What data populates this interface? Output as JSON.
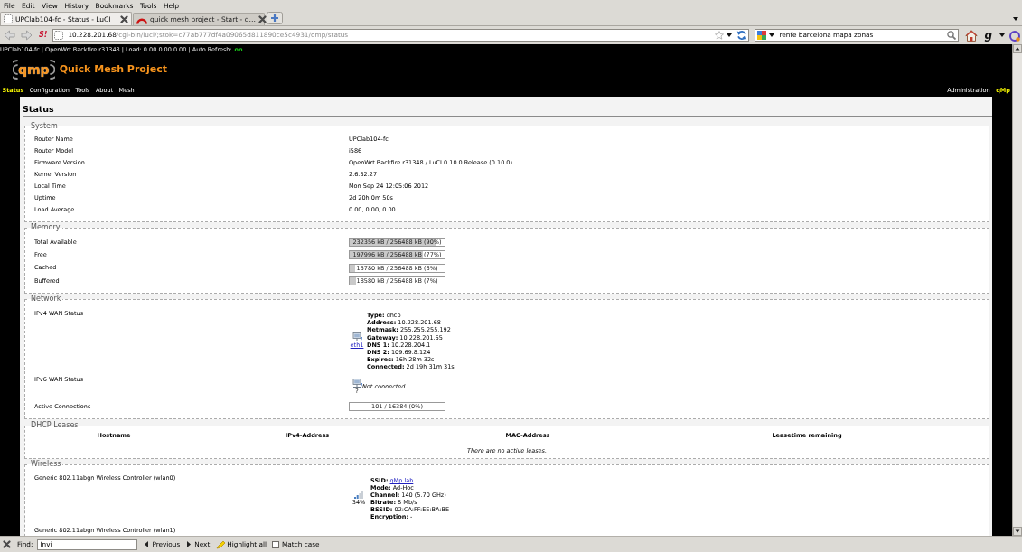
{
  "menu_bar": [
    "File",
    "Edit",
    "View",
    "History",
    "Bookmarks",
    "Tools",
    "Help"
  ],
  "tabs": [
    {
      "title": "UPClab104-fc - Status - LuCI",
      "kind": "blank",
      "selected": true
    },
    {
      "title": "quick mesh project - Start - q…",
      "kind": "arc",
      "selected": false
    }
  ],
  "toolbar": {
    "addon_label": "S!",
    "url_host": "10.228.201.68",
    "url_path": "/cgi-bin/luci/;stok=c77ab777df4a09065d811890ce5c4931/qmp/status",
    "search_value": "renfe barcelona mapa zonas",
    "addon_g": "g"
  },
  "page": {
    "info_line": "UPClab104-fc | OpenWrt Backfire r31348 | Load: 0.00 0.00 0.00 | Auto Refresh:",
    "auto_refresh": "on",
    "logo_text": "qmp",
    "site_title": "Quick Mesh Project",
    "menu": [
      {
        "label": "Status",
        "selected": true
      },
      {
        "label": "Configuration",
        "selected": false
      },
      {
        "label": "Tools",
        "selected": false
      },
      {
        "label": "About",
        "selected": false
      },
      {
        "label": "Mesh",
        "selected": false
      }
    ],
    "menu_right": [
      {
        "label": "Administration",
        "selected": false
      },
      {
        "label": "qMp",
        "selected": true
      }
    ],
    "heading": "Status",
    "system": {
      "legend": "System",
      "rows": [
        {
          "label": "Router Name",
          "value": "UPClab104-fc"
        },
        {
          "label": "Router Model",
          "value": "i586"
        },
        {
          "label": "Firmware Version",
          "value": "OpenWrt Backfire r31348 / LuCI 0.10.0 Release (0.10.0)"
        },
        {
          "label": "Kernel Version",
          "value": "2.6.32.27"
        },
        {
          "label": "Local Time",
          "value": "Mon Sep 24 12:05:06 2012"
        },
        {
          "label": "Uptime",
          "value": "2d 20h 0m 50s"
        },
        {
          "label": "Load Average",
          "value": "0.00, 0.00, 0.00"
        }
      ]
    },
    "memory": {
      "legend": "Memory",
      "rows": [
        {
          "label": "Total Available",
          "reading": "232356 kB / 256488 kB (90%)",
          "level": 0.9
        },
        {
          "label": "Free",
          "reading": "197996 kB / 256488 kB (77%)",
          "level": 0.77
        },
        {
          "label": "Cached",
          "reading": "15780 kB / 256488 kB (6%)",
          "level": 0.06
        },
        {
          "label": "Buffered",
          "reading": "18580 kB / 256488 kB (7%)",
          "level": 0.07
        }
      ]
    },
    "network": {
      "legend": "Network",
      "ipv4": {
        "label": "IPv4 WAN Status",
        "interface": "eth1",
        "details": [
          "**Type:** dhcp",
          "**Address:** 10.228.201.68",
          "**Netmask:** 255.255.255.192",
          "**Gateway:** 10.228.201.65",
          "**DNS 1:** 10.228.204.1",
          "**DNS 2:** 109.69.8.124",
          "**Expires:** 16h 28m 32s",
          "**Connected:** 2d 19h 31m 31s"
        ]
      },
      "ipv6": {
        "label": "IPv6 WAN Status",
        "icon_caption": "?",
        "status": "Not connected"
      },
      "connections": {
        "label": "Active Connections",
        "reading": "101 / 16384 (0%)"
      }
    },
    "dhcp": {
      "legend": "DHCP Leases",
      "columns": [
        "Hostname",
        "IPv4-Address",
        "MAC-Address",
        "Leasetime remaining"
      ],
      "empty_message": "There are no active leases."
    },
    "wireless": {
      "legend": "Wireless",
      "devices": [
        {
          "name": "Generic 802.11abgn Wireless Controller (wlan0)",
          "signal": "34%",
          "details": [
            {
              "kind": "link",
              "label": "SSID:",
              "value": "qMp.lab"
            },
            {
              "kind": "text",
              "text": "**Mode:** Ad-Hoc"
            },
            {
              "kind": "text",
              "text": "**Channel:** 140 (5.70 GHz)"
            },
            {
              "kind": "text",
              "text": "**Bitrate:** 8 Mb/s"
            },
            {
              "kind": "text",
              "text": "**BSSID:** 02:CA:FF:EE:BA:BE"
            },
            {
              "kind": "text",
              "text": "**Encryption:** -"
            }
          ]
        },
        {
          "name": "Generic 802.11abgn Wireless Controller (wlan1)"
        }
      ]
    }
  },
  "find_bar": {
    "label": "Find:",
    "value": "Invi",
    "previous": "Previous",
    "next": "Next",
    "highlight_all": "Highlight all",
    "match_case": {
      "label": "Match case",
      "checked": false
    }
  }
}
